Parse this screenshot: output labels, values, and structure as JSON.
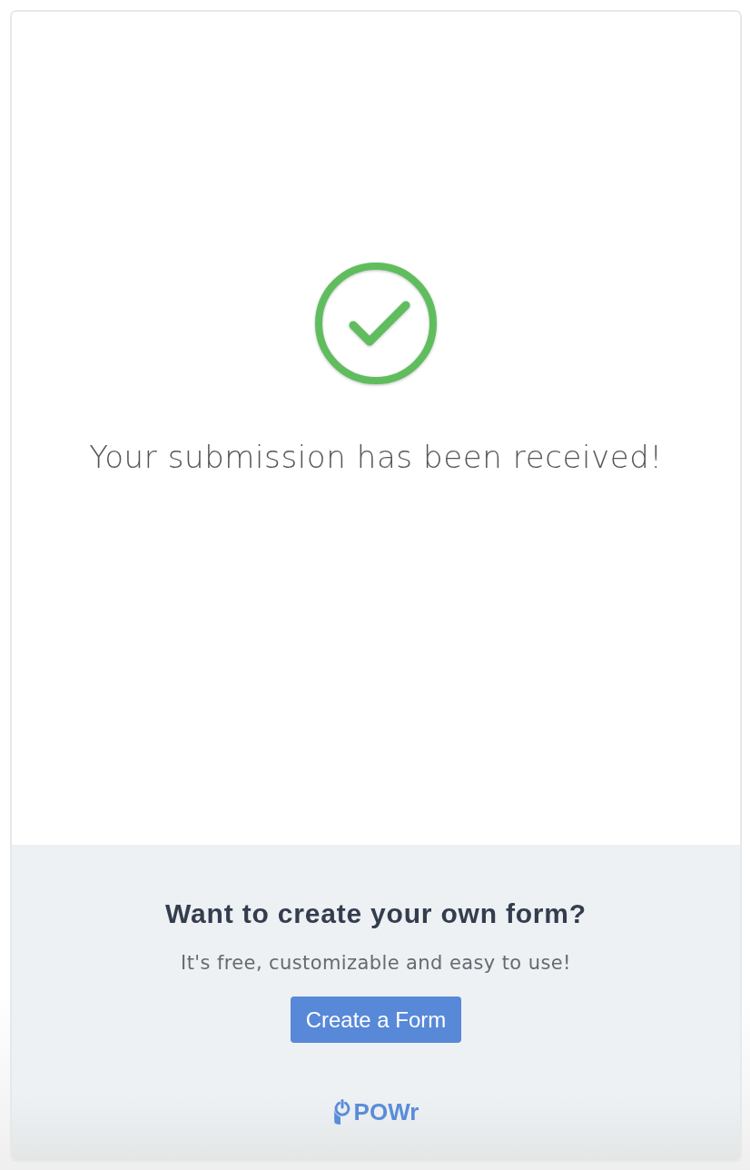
{
  "confirmation": {
    "kind": "success",
    "message": "Your submission has been received!"
  },
  "promo": {
    "heading": "Want to create your own form?",
    "subheading": "It's free, customizable and easy to use!",
    "button": "Create a Form",
    "brand": "POWr"
  }
}
